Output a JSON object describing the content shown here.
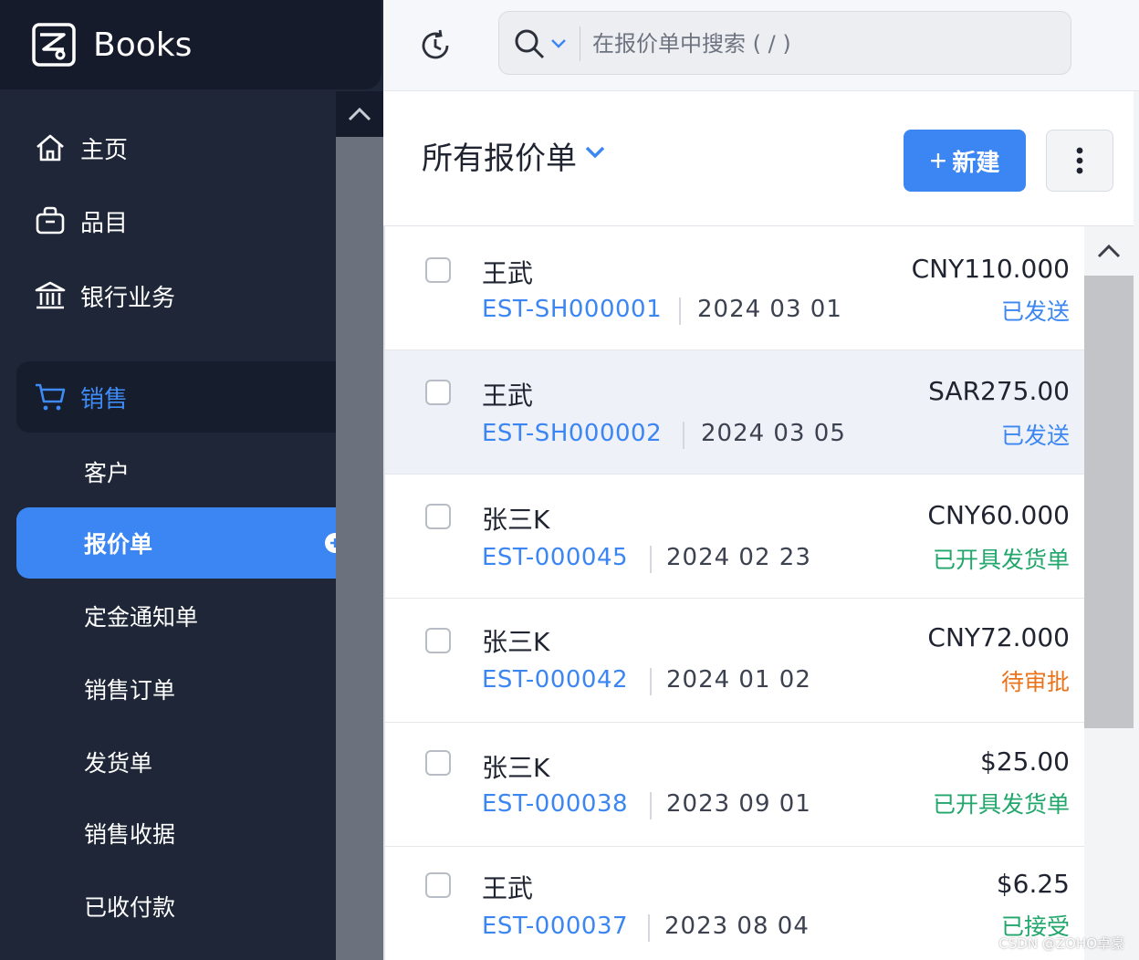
{
  "app": {
    "name": "Books"
  },
  "nav": {
    "items": [
      {
        "label": "主页",
        "icon": "home-icon"
      },
      {
        "label": "品目",
        "icon": "bag-icon"
      },
      {
        "label": "银行业务",
        "icon": "bank-icon"
      }
    ],
    "sales": {
      "label": "销售",
      "icon": "cart-icon"
    },
    "sub_items": [
      {
        "label": "客户"
      },
      {
        "label": "报价单",
        "active": true
      },
      {
        "label": "定金通知单"
      },
      {
        "label": "销售订单"
      },
      {
        "label": "发货单"
      },
      {
        "label": "销售收据"
      },
      {
        "label": "已收付款"
      }
    ]
  },
  "search": {
    "placeholder": "在报价单中搜索 ( / )"
  },
  "header": {
    "title": "所有报价单",
    "new_label": "新建",
    "new_plus": "+"
  },
  "colors": {
    "accent": "#3b86f3",
    "sidebar": "#1e2637",
    "status_sent": "#3b86f3",
    "status_invoiced": "#21a66b",
    "status_pending": "#e8731a",
    "status_accepted": "#21a66b"
  },
  "quotes": [
    {
      "customer": "王武",
      "number": "EST-SH000001",
      "date": "2024 03 01",
      "amount": "CNY110.000",
      "status": "已发送",
      "status_color": "#3b86f3"
    },
    {
      "customer": "王武",
      "number": "EST-SH000002",
      "date": "2024 03 05",
      "amount": "SAR275.00",
      "status": "已发送",
      "status_color": "#3b86f3"
    },
    {
      "customer": "张三K",
      "number": "EST-000045",
      "date": "2024 02 23",
      "amount": "CNY60.000",
      "status": "已开具发货单",
      "status_color": "#21a66b"
    },
    {
      "customer": "张三K",
      "number": "EST-000042",
      "date": "2024 01 02",
      "amount": "CNY72.000",
      "status": "待审批",
      "status_color": "#e8731a"
    },
    {
      "customer": "张三K",
      "number": "EST-000038",
      "date": "2023 09 01",
      "amount": "$25.00",
      "status": "已开具发货单",
      "status_color": "#21a66b"
    },
    {
      "customer": "王武",
      "number": "EST-000037",
      "date": "2023 08 04",
      "amount": "$6.25",
      "status": "已接受",
      "status_color": "#21a66b"
    }
  ],
  "watermark": "CSDN @ZOHO卓豪"
}
